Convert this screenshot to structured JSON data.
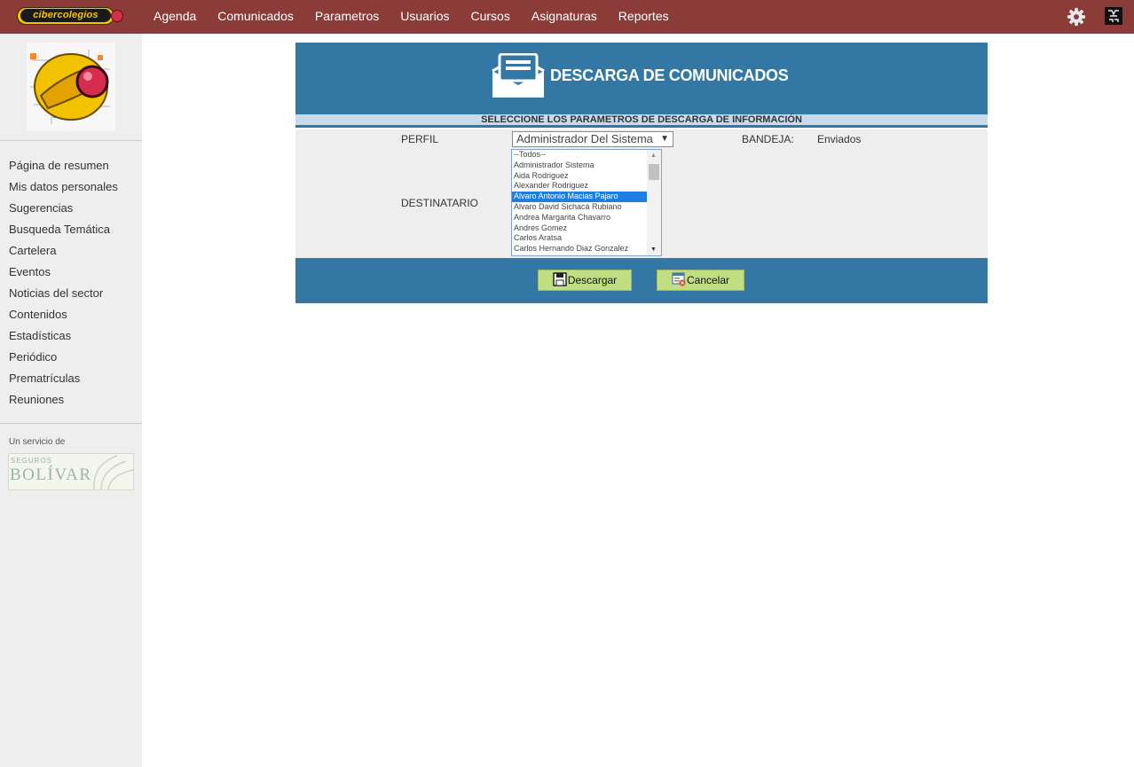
{
  "brand": {
    "logo_text": "cibercolegios"
  },
  "nav": {
    "items": [
      {
        "label": "Agenda"
      },
      {
        "label": "Comunicados"
      },
      {
        "label": "Parametros"
      },
      {
        "label": "Usuarios"
      },
      {
        "label": "Cursos"
      },
      {
        "label": "Asignaturas"
      },
      {
        "label": "Reportes"
      }
    ]
  },
  "sidebar": {
    "items": [
      {
        "label": "Página de resumen"
      },
      {
        "label": "Mis datos personales"
      },
      {
        "label": "Sugerencias"
      },
      {
        "label": "Busqueda Temática"
      },
      {
        "label": "Cartelera"
      },
      {
        "label": "Eventos"
      },
      {
        "label": "Noticias del sector"
      },
      {
        "label": "Contenidos"
      },
      {
        "label": "Estadísticas"
      },
      {
        "label": "Periódico"
      },
      {
        "label": "Prematrículas"
      },
      {
        "label": "Reuniones"
      }
    ],
    "service_label": "Un servicio de",
    "sponsor": {
      "small": "SEGUROS",
      "big": "BOLÍVAR"
    }
  },
  "panel": {
    "title": "DESCARGA DE COMUNICADOS",
    "subtitle": "SELECCIONE LOS PARAMETROS DE DESCARGA DE INFORMACIÓN",
    "perfil_label": "PERFIL",
    "perfil_value": "Administrador Del Sistema",
    "bandeja_label": "BANDEJA:",
    "bandeja_value": "Enviados",
    "destinatario_label": "DESTINATARIO",
    "destinatarios": [
      {
        "label": "--Todos--"
      },
      {
        "label": "Administrador Sistema"
      },
      {
        "label": "Aida Rodriguez"
      },
      {
        "label": "Alexander Rodriguez"
      },
      {
        "label": "Alvaro Antonio Macias Pajaro",
        "selected": true
      },
      {
        "label": "Alvaro David Sichacá Rubiano"
      },
      {
        "label": "Andrea Margarita Chavarro"
      },
      {
        "label": "Andres Gomez"
      },
      {
        "label": "Carlos Aratsa"
      },
      {
        "label": "Carlos Hernando Diaz Gonzalez"
      }
    ],
    "buttons": {
      "download": "Descargar",
      "cancel": "Cancelar"
    }
  },
  "colors": {
    "topbar": "#8b3c38",
    "panel_blue": "#3378a5",
    "subtitle_bar": "#c8daec",
    "button_green": "#c0de82",
    "selected_option": "#1e7fe0",
    "sidebar_bg": "#eeeeee"
  },
  "icons": {
    "settings": "gear-icon",
    "user": "user-avatar-icon",
    "header": "envelope-icon",
    "download": "floppy-disk-icon",
    "cancel": "cancel-form-icon"
  }
}
